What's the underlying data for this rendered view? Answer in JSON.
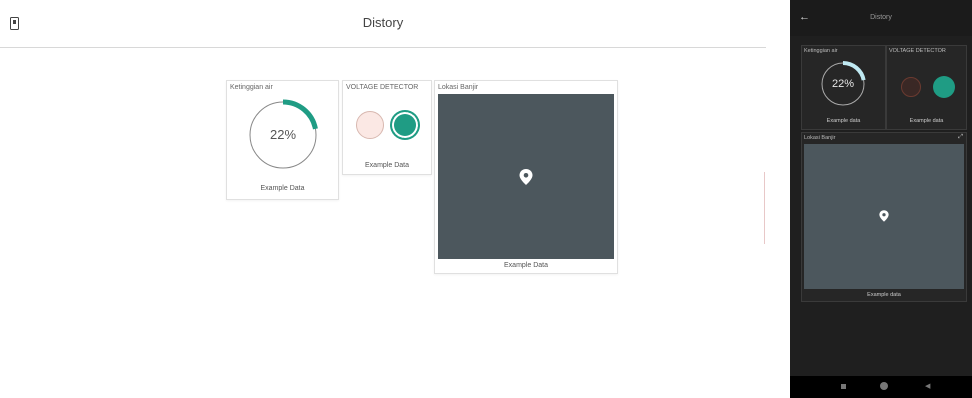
{
  "desktop": {
    "title": "Distory",
    "gauge_card": {
      "title": "Ketinggian air",
      "value_text": "22%",
      "value": 0.22,
      "footer": "Example Data"
    },
    "voltage_card": {
      "title": "VOLTAGE DETECTOR",
      "footer": "Example Data"
    },
    "map_card": {
      "title": "Lokasi Banjir",
      "footer": "Example Data"
    }
  },
  "mobile": {
    "title": "Distory",
    "gauge_card": {
      "title": "Ketinggian air",
      "value_text": "22%",
      "value": 0.22,
      "footer": "Example data"
    },
    "voltage_card": {
      "title": "VOLTAGE DETECTOR",
      "footer": "Example data"
    },
    "map_card": {
      "title": "Lokasi Banjir",
      "footer": "Example data"
    }
  },
  "colors": {
    "accent": "#1f9c84",
    "gauge_track": "#888888",
    "gauge_mobile_arc": "#bfe9f2",
    "map": "#4c575d",
    "led_off_light": "#fbe8e4",
    "led_off_dark": "#3a2825"
  },
  "icons": {
    "desktop_menu": "phone-icon",
    "mobile_back": "arrow-left-icon",
    "map_pin": "map-pin-icon",
    "expand": "expand-icon",
    "nav": [
      "square-icon",
      "circle-icon",
      "triangle-back-icon"
    ]
  }
}
